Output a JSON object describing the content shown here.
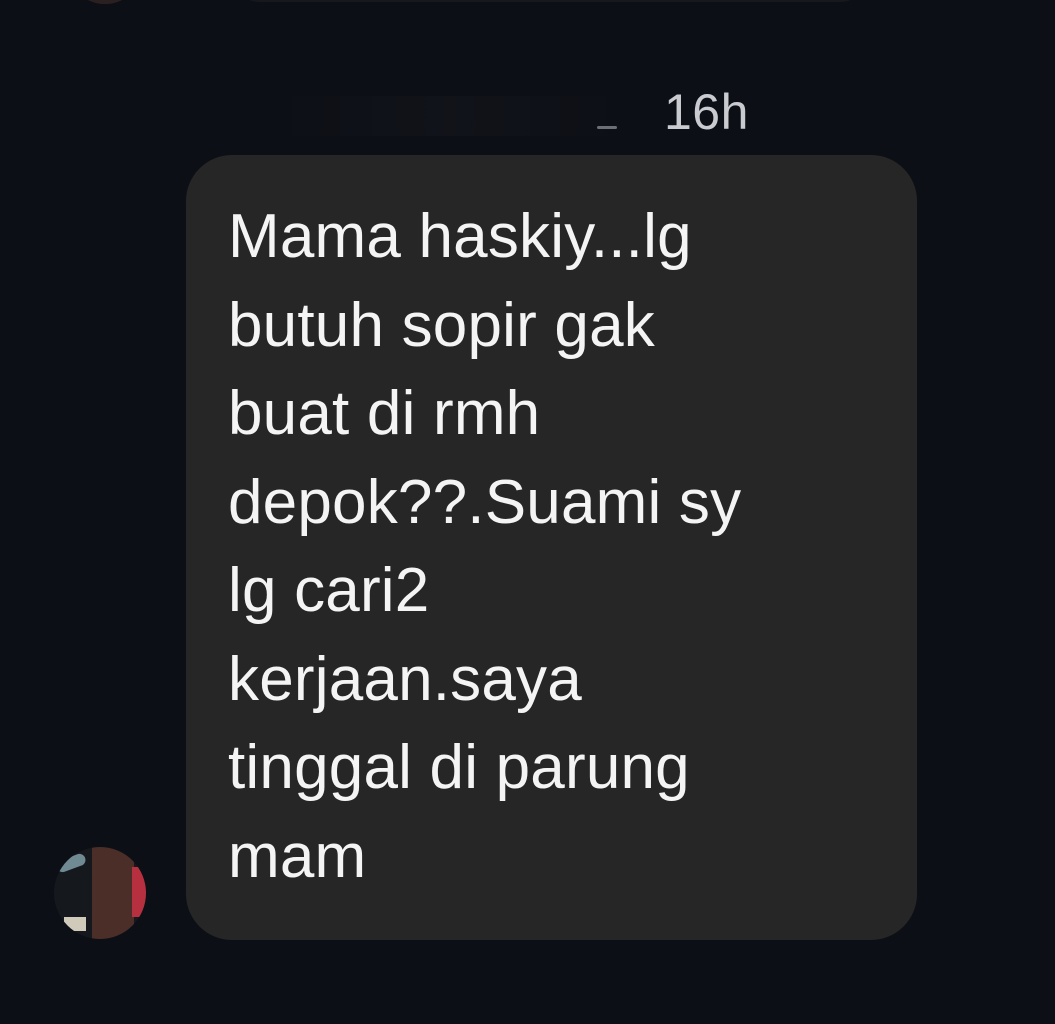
{
  "message": {
    "timestamp": "16h",
    "text": "Mama haskiy...lg\nbutuh sopir gak\nbuat di rmh\ndepok??.Suami sy\nlg cari2\nkerjaan.saya\ntinggal di parung\nmam"
  },
  "colors": {
    "background": "#0c0f15",
    "bubble": "#262626",
    "text": "#f4f4f4",
    "timestamp": "#c9cbd0"
  }
}
